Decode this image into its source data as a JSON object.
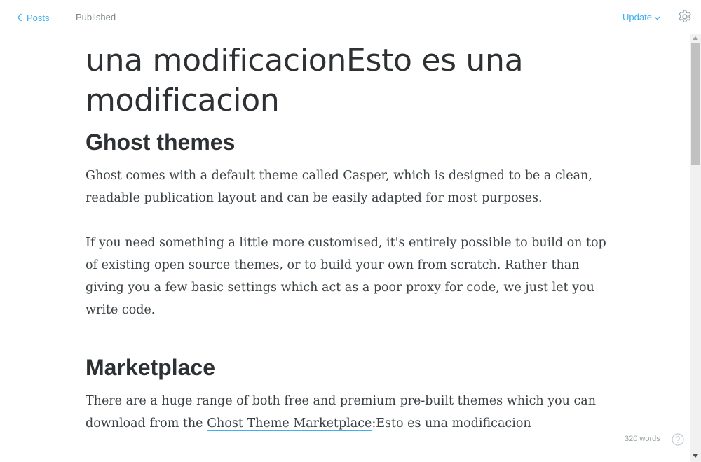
{
  "header": {
    "back_label": "Posts",
    "status": "Published",
    "update_label": "Update"
  },
  "editor": {
    "title_line1": "una modificacionEsto es una",
    "title_line2": "modificacion",
    "sections": [
      {
        "heading": "Ghost themes",
        "paragraphs": [
          "Ghost comes with a default theme called Casper, which is designed to be a clean, readable publication layout and can be easily adapted for most purposes.",
          "If you need something a little more customised, it's entirely possible to build on top of existing open source themes, or to build your own from scratch. Rather than giving you a few basic settings which act as a poor proxy for code, we just let you write code."
        ]
      },
      {
        "heading": "Marketplace",
        "paragraph_prefix": "There are a huge range of both free and premium pre-built themes which you can download from the ",
        "link_text": "Ghost Theme Marketplace",
        "paragraph_suffix": ":Esto es una modificacion"
      }
    ]
  },
  "footer": {
    "word_count": "320 words"
  },
  "icons": {
    "back": "chevron-left-icon",
    "update": "chevron-down-icon",
    "settings": "gear-icon",
    "help": "question-circle-icon"
  },
  "colors": {
    "accent": "#3eb0ef",
    "heading": "#2e3133",
    "body_text": "#3a4145",
    "muted": "#7d878a"
  }
}
